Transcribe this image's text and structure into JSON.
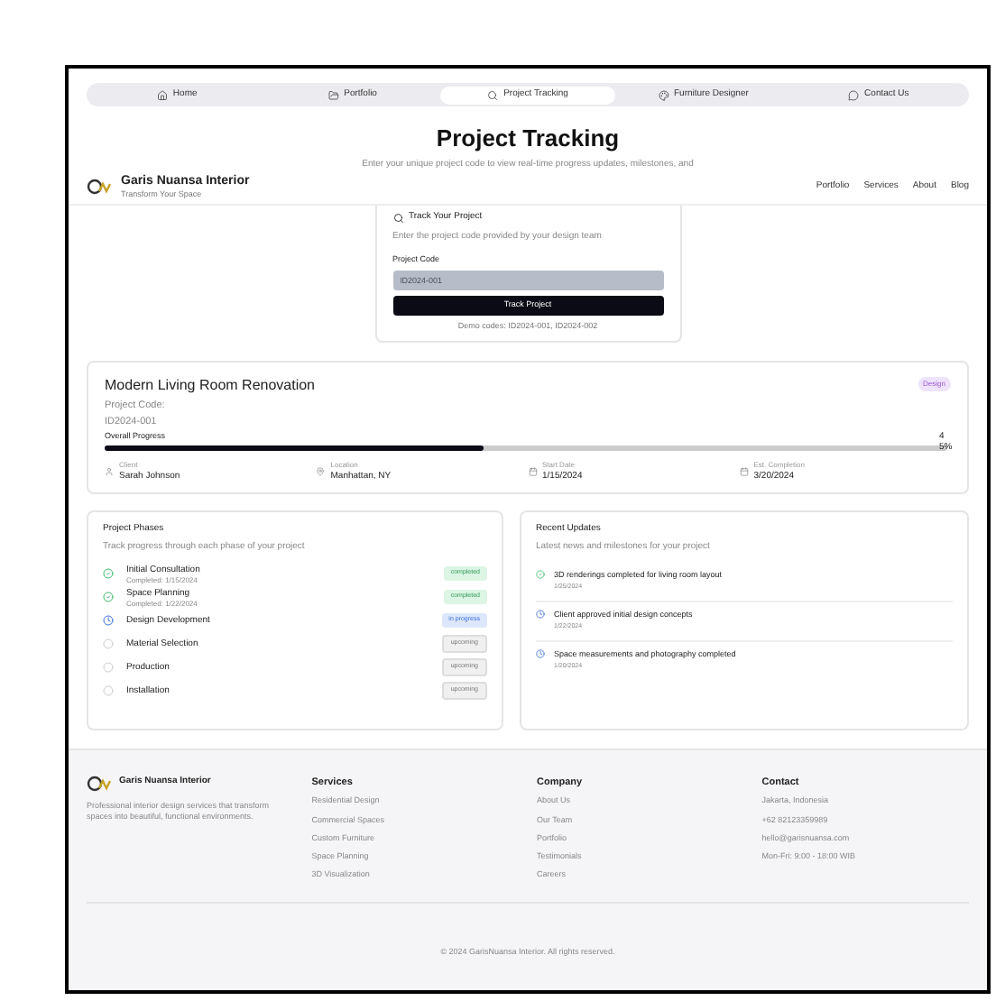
{
  "nav_tabs": [
    {
      "label": "Home",
      "selected": false
    },
    {
      "label": "Portfolio",
      "selected": false
    },
    {
      "label": "Project Tracking",
      "selected": true
    },
    {
      "label": "Furniture Designer",
      "selected": false
    },
    {
      "label": "Contact Us",
      "selected": false
    }
  ],
  "title": "Project Tracking",
  "subtitle": "Enter your unique project code to view real-time progress updates, milestones, and",
  "header": {
    "brand": "Garis Nuansa Interior",
    "tagline": "Transform Your Space",
    "links": [
      "Portfolio",
      "Services",
      "About",
      "Blog"
    ]
  },
  "track_card": {
    "title": "Track Your Project",
    "description": "Enter the project code provided by your design team",
    "field_label": "Project Code",
    "placeholder": "ID2024-001",
    "button": "Track Project",
    "demo": "Demo codes: ID2024-001, ID2024-002"
  },
  "project": {
    "name": "Modern Living Room Renovation",
    "badge": "Design",
    "code_label": "Project Code:",
    "code": "ID2024-001",
    "progress_label": "Overall Progress",
    "level": 0.45,
    "reading": "45%",
    "details": [
      {
        "label": "Client",
        "value": "Sarah Johnson"
      },
      {
        "label": "Location",
        "value": "Manhattan, NY"
      },
      {
        "label": "Start Date",
        "value": "1/15/2024"
      },
      {
        "label": "Est. Completion",
        "value": "3/20/2024"
      }
    ]
  },
  "phases": {
    "title": "Project Phases",
    "description": "Track progress through each phase of your project",
    "items": [
      {
        "name": "Initial Consultation",
        "date": "Completed: 1/15/2024",
        "kind": "done",
        "badge": "completed"
      },
      {
        "name": "Space Planning",
        "date": "Completed: 1/22/2024",
        "kind": "done",
        "badge": "completed"
      },
      {
        "name": "Design Development",
        "kind": "active",
        "badge": "in progress"
      },
      {
        "name": "Material Selection",
        "kind": "pending",
        "badge": "upcoming"
      },
      {
        "name": "Production",
        "kind": "pending",
        "badge": "upcoming"
      },
      {
        "name": "Installation",
        "kind": "pending",
        "badge": "upcoming"
      }
    ]
  },
  "updates": {
    "title": "Recent Updates",
    "description": "Latest news and milestones for your project",
    "items": [
      {
        "kind": "done",
        "text": "3D renderings completed for living room layout",
        "date": "1/25/2024"
      },
      {
        "kind": "info",
        "text": "Client approved initial design concepts",
        "date": "1/22/2024"
      },
      {
        "kind": "info",
        "text": "Space measurements and photography completed",
        "date": "1/20/2024"
      }
    ]
  },
  "footer": {
    "brand": "Garis Nuansa Interior",
    "about": "Professional interior design services that transform spaces into beautiful, functional environments.",
    "columns": [
      {
        "title": "Services",
        "items": [
          "Residential Design",
          "Commercial Spaces",
          "Custom Furniture",
          "Space Planning",
          "3D Visualization"
        ]
      },
      {
        "title": "Company",
        "items": [
          "About Us",
          "Our Team",
          "Portfolio",
          "Testimonials",
          "Careers"
        ]
      },
      {
        "title": "Contact",
        "items": [
          "Jakarta, Indonesia",
          "+62 82123359989",
          "hello@garisnuansa.com",
          "Mon-Fri: 9:00 - 18:00 WIB"
        ]
      }
    ],
    "copyright": "© 2024 GarisNuansa Interior. All rights reserved."
  }
}
